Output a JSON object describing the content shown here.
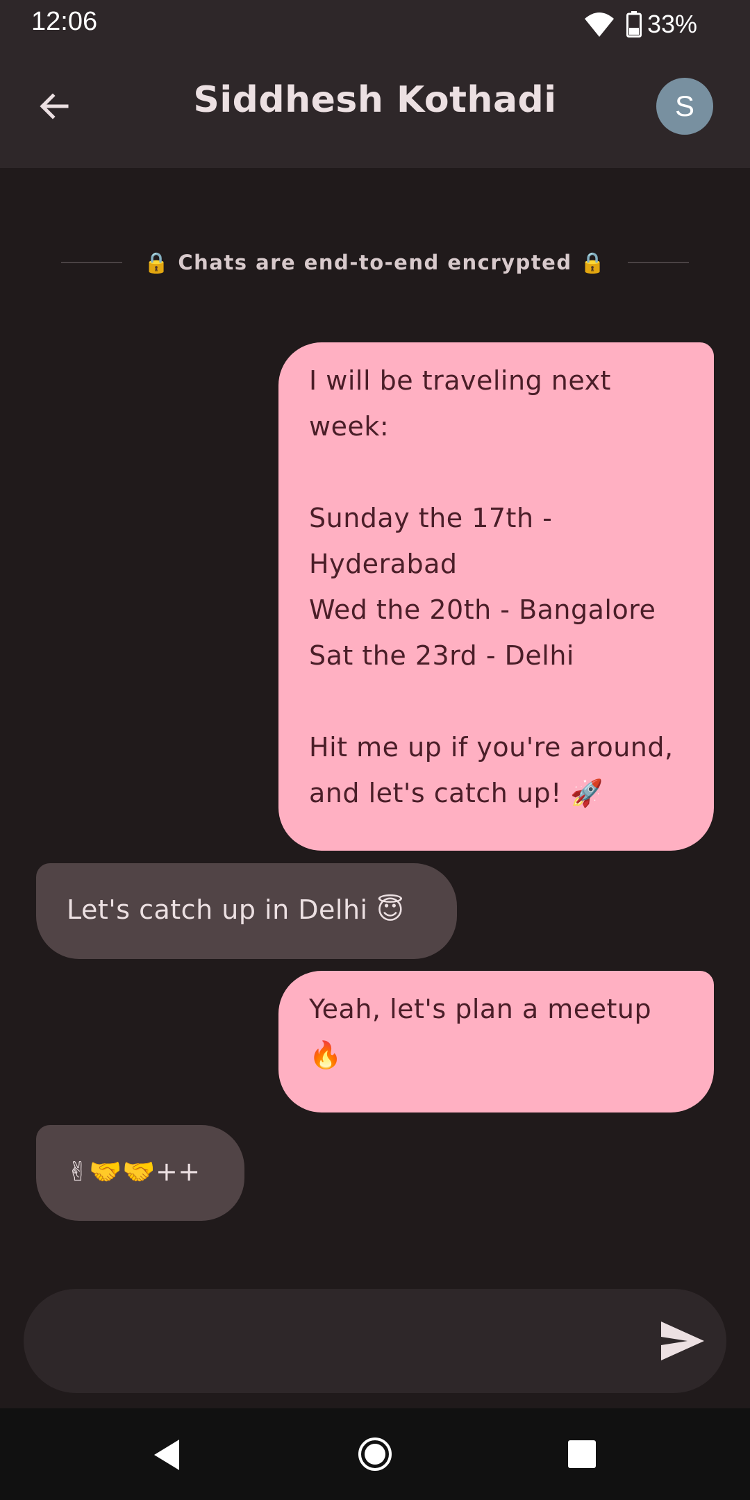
{
  "status_bar": {
    "time": "12:06",
    "battery": "33%",
    "icons": [
      "wifi-icon",
      "battery-icon"
    ]
  },
  "header": {
    "title": "Siddhesh Kothadi",
    "avatar_initial": "S",
    "avatar_color": "#7890a0",
    "back_icon": "arrow-left-icon"
  },
  "notice": {
    "text": "🔒 Chats are end-to-end encrypted 🔒"
  },
  "messages": [
    {
      "direction": "sent",
      "text": "I will be traveling next week:\n\nSunday the 17th - Hyderabad\nWed the 20th - Bangalore\nSat the 23rd - Delhi\n\nHit me up if you're around, and let's catch up! 🚀"
    },
    {
      "direction": "received",
      "text": "Let's catch up in Delhi 😇"
    },
    {
      "direction": "sent",
      "text": "Yeah, let's plan a meetup 🔥"
    },
    {
      "direction": "received",
      "text": "✌🤝🤝++"
    }
  ],
  "composer": {
    "value": "",
    "placeholder": "",
    "send_icon": "send-icon"
  },
  "nav_bar": {
    "icons": [
      "nav-back-icon",
      "nav-home-icon",
      "nav-recents-icon"
    ]
  },
  "colors": {
    "background": "#201a1b",
    "bar": "#2e2729",
    "sent_bubble": "#ffb0c2",
    "sent_text": "#4a1e28",
    "received_bubble": "#514446",
    "received_text": "#ece0e2"
  }
}
